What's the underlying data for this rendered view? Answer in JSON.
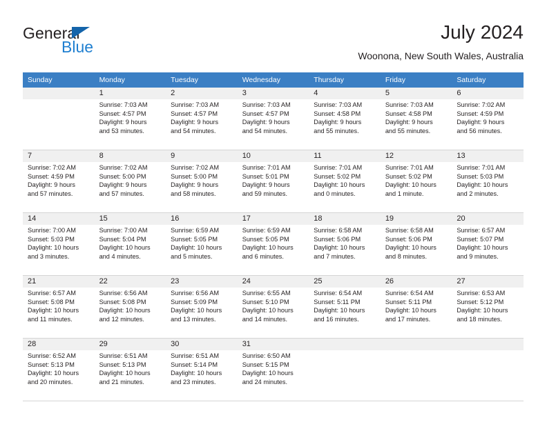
{
  "brand": {
    "name_part1": "General",
    "name_part2": "Blue",
    "triangle_color": "#1464aa",
    "blue_color": "#1f7fd0"
  },
  "header": {
    "title": "July 2024",
    "subtitle": "Woonona, New South Wales, Australia"
  },
  "theme": {
    "header_row_bg": "#3b7fc4",
    "header_row_text": "#ffffff",
    "cell_shaded_bg": "#f0f0f0",
    "grid_line": "#d4d4d4",
    "text": "#231f20"
  },
  "weekdays": [
    "Sunday",
    "Monday",
    "Tuesday",
    "Wednesday",
    "Thursday",
    "Friday",
    "Saturday"
  ],
  "weeks": [
    [
      {
        "day": "",
        "lines": []
      },
      {
        "day": "1",
        "lines": [
          "Sunrise: 7:03 AM",
          "Sunset: 4:57 PM",
          "Daylight: 9 hours",
          "and 53 minutes."
        ]
      },
      {
        "day": "2",
        "lines": [
          "Sunrise: 7:03 AM",
          "Sunset: 4:57 PM",
          "Daylight: 9 hours",
          "and 54 minutes."
        ]
      },
      {
        "day": "3",
        "lines": [
          "Sunrise: 7:03 AM",
          "Sunset: 4:57 PM",
          "Daylight: 9 hours",
          "and 54 minutes."
        ]
      },
      {
        "day": "4",
        "lines": [
          "Sunrise: 7:03 AM",
          "Sunset: 4:58 PM",
          "Daylight: 9 hours",
          "and 55 minutes."
        ]
      },
      {
        "day": "5",
        "lines": [
          "Sunrise: 7:03 AM",
          "Sunset: 4:58 PM",
          "Daylight: 9 hours",
          "and 55 minutes."
        ]
      },
      {
        "day": "6",
        "lines": [
          "Sunrise: 7:02 AM",
          "Sunset: 4:59 PM",
          "Daylight: 9 hours",
          "and 56 minutes."
        ]
      }
    ],
    [
      {
        "day": "7",
        "lines": [
          "Sunrise: 7:02 AM",
          "Sunset: 4:59 PM",
          "Daylight: 9 hours",
          "and 57 minutes."
        ]
      },
      {
        "day": "8",
        "lines": [
          "Sunrise: 7:02 AM",
          "Sunset: 5:00 PM",
          "Daylight: 9 hours",
          "and 57 minutes."
        ]
      },
      {
        "day": "9",
        "lines": [
          "Sunrise: 7:02 AM",
          "Sunset: 5:00 PM",
          "Daylight: 9 hours",
          "and 58 minutes."
        ]
      },
      {
        "day": "10",
        "lines": [
          "Sunrise: 7:01 AM",
          "Sunset: 5:01 PM",
          "Daylight: 9 hours",
          "and 59 minutes."
        ]
      },
      {
        "day": "11",
        "lines": [
          "Sunrise: 7:01 AM",
          "Sunset: 5:02 PM",
          "Daylight: 10 hours",
          "and 0 minutes."
        ]
      },
      {
        "day": "12",
        "lines": [
          "Sunrise: 7:01 AM",
          "Sunset: 5:02 PM",
          "Daylight: 10 hours",
          "and 1 minute."
        ]
      },
      {
        "day": "13",
        "lines": [
          "Sunrise: 7:01 AM",
          "Sunset: 5:03 PM",
          "Daylight: 10 hours",
          "and 2 minutes."
        ]
      }
    ],
    [
      {
        "day": "14",
        "lines": [
          "Sunrise: 7:00 AM",
          "Sunset: 5:03 PM",
          "Daylight: 10 hours",
          "and 3 minutes."
        ]
      },
      {
        "day": "15",
        "lines": [
          "Sunrise: 7:00 AM",
          "Sunset: 5:04 PM",
          "Daylight: 10 hours",
          "and 4 minutes."
        ]
      },
      {
        "day": "16",
        "lines": [
          "Sunrise: 6:59 AM",
          "Sunset: 5:05 PM",
          "Daylight: 10 hours",
          "and 5 minutes."
        ]
      },
      {
        "day": "17",
        "lines": [
          "Sunrise: 6:59 AM",
          "Sunset: 5:05 PM",
          "Daylight: 10 hours",
          "and 6 minutes."
        ]
      },
      {
        "day": "18",
        "lines": [
          "Sunrise: 6:58 AM",
          "Sunset: 5:06 PM",
          "Daylight: 10 hours",
          "and 7 minutes."
        ]
      },
      {
        "day": "19",
        "lines": [
          "Sunrise: 6:58 AM",
          "Sunset: 5:06 PM",
          "Daylight: 10 hours",
          "and 8 minutes."
        ]
      },
      {
        "day": "20",
        "lines": [
          "Sunrise: 6:57 AM",
          "Sunset: 5:07 PM",
          "Daylight: 10 hours",
          "and 9 minutes."
        ]
      }
    ],
    [
      {
        "day": "21",
        "lines": [
          "Sunrise: 6:57 AM",
          "Sunset: 5:08 PM",
          "Daylight: 10 hours",
          "and 11 minutes."
        ]
      },
      {
        "day": "22",
        "lines": [
          "Sunrise: 6:56 AM",
          "Sunset: 5:08 PM",
          "Daylight: 10 hours",
          "and 12 minutes."
        ]
      },
      {
        "day": "23",
        "lines": [
          "Sunrise: 6:56 AM",
          "Sunset: 5:09 PM",
          "Daylight: 10 hours",
          "and 13 minutes."
        ]
      },
      {
        "day": "24",
        "lines": [
          "Sunrise: 6:55 AM",
          "Sunset: 5:10 PM",
          "Daylight: 10 hours",
          "and 14 minutes."
        ]
      },
      {
        "day": "25",
        "lines": [
          "Sunrise: 6:54 AM",
          "Sunset: 5:11 PM",
          "Daylight: 10 hours",
          "and 16 minutes."
        ]
      },
      {
        "day": "26",
        "lines": [
          "Sunrise: 6:54 AM",
          "Sunset: 5:11 PM",
          "Daylight: 10 hours",
          "and 17 minutes."
        ]
      },
      {
        "day": "27",
        "lines": [
          "Sunrise: 6:53 AM",
          "Sunset: 5:12 PM",
          "Daylight: 10 hours",
          "and 18 minutes."
        ]
      }
    ],
    [
      {
        "day": "28",
        "lines": [
          "Sunrise: 6:52 AM",
          "Sunset: 5:13 PM",
          "Daylight: 10 hours",
          "and 20 minutes."
        ]
      },
      {
        "day": "29",
        "lines": [
          "Sunrise: 6:51 AM",
          "Sunset: 5:13 PM",
          "Daylight: 10 hours",
          "and 21 minutes."
        ]
      },
      {
        "day": "30",
        "lines": [
          "Sunrise: 6:51 AM",
          "Sunset: 5:14 PM",
          "Daylight: 10 hours",
          "and 23 minutes."
        ]
      },
      {
        "day": "31",
        "lines": [
          "Sunrise: 6:50 AM",
          "Sunset: 5:15 PM",
          "Daylight: 10 hours",
          "and 24 minutes."
        ]
      },
      {
        "day": "",
        "lines": []
      },
      {
        "day": "",
        "lines": []
      },
      {
        "day": "",
        "lines": []
      }
    ]
  ]
}
